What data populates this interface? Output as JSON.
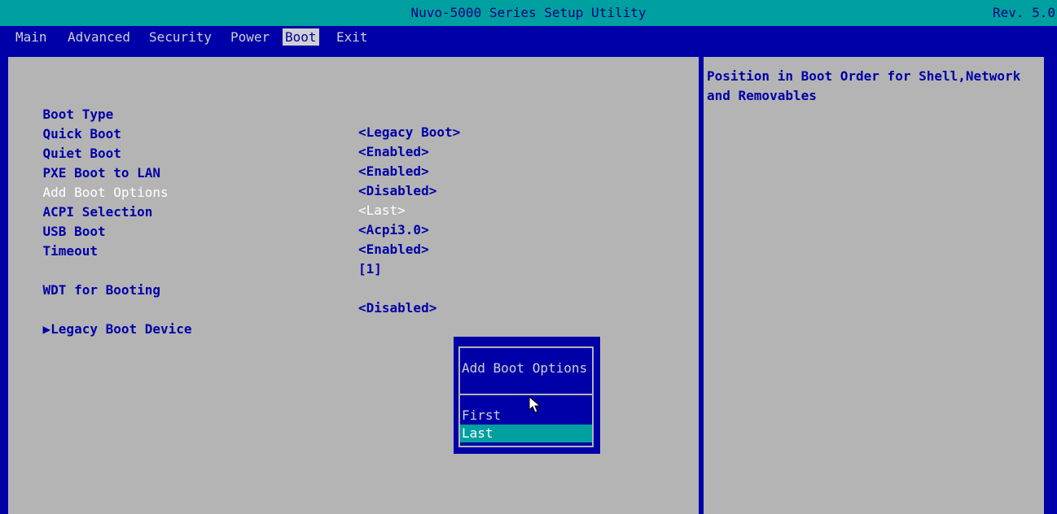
{
  "header": {
    "title": "Nuvo-5000 Series Setup Utility",
    "revision": "Rev. 5.0"
  },
  "menu": {
    "items": [
      {
        "label": "Main"
      },
      {
        "label": "Advanced"
      },
      {
        "label": "Security"
      },
      {
        "label": "Power"
      },
      {
        "label": "Boot"
      },
      {
        "label": "Exit"
      }
    ],
    "active": "Boot"
  },
  "settings": [
    {
      "label": "Boot Type",
      "value": "<Legacy Boot>"
    },
    {
      "label": "Quick Boot",
      "value": "<Enabled>"
    },
    {
      "label": "Quiet Boot",
      "value": "<Enabled>"
    },
    {
      "label": "PXE Boot to LAN",
      "value": "<Disabled>"
    },
    {
      "label": "Add Boot Options",
      "value": "<Last>"
    },
    {
      "label": "ACPI Selection",
      "value": "<Acpi3.0>"
    },
    {
      "label": "USB Boot",
      "value": "<Enabled>"
    },
    {
      "label": "Timeout",
      "value": "[1]"
    },
    {
      "label": "WDT for Booting",
      "value": "<Disabled>"
    },
    {
      "label": "▶Legacy Boot Device",
      "value": ""
    }
  ],
  "help": {
    "text": "Position in Boot Order for Shell,Network and Removables"
  },
  "popup": {
    "title": "Add Boot Options",
    "options": [
      "First",
      "Last"
    ],
    "selected": "Last"
  },
  "colors": {
    "background": "#0000a8",
    "title_bar": "#00a0a0",
    "panel": "#b4b4b4",
    "highlight": "#00a0a0"
  }
}
